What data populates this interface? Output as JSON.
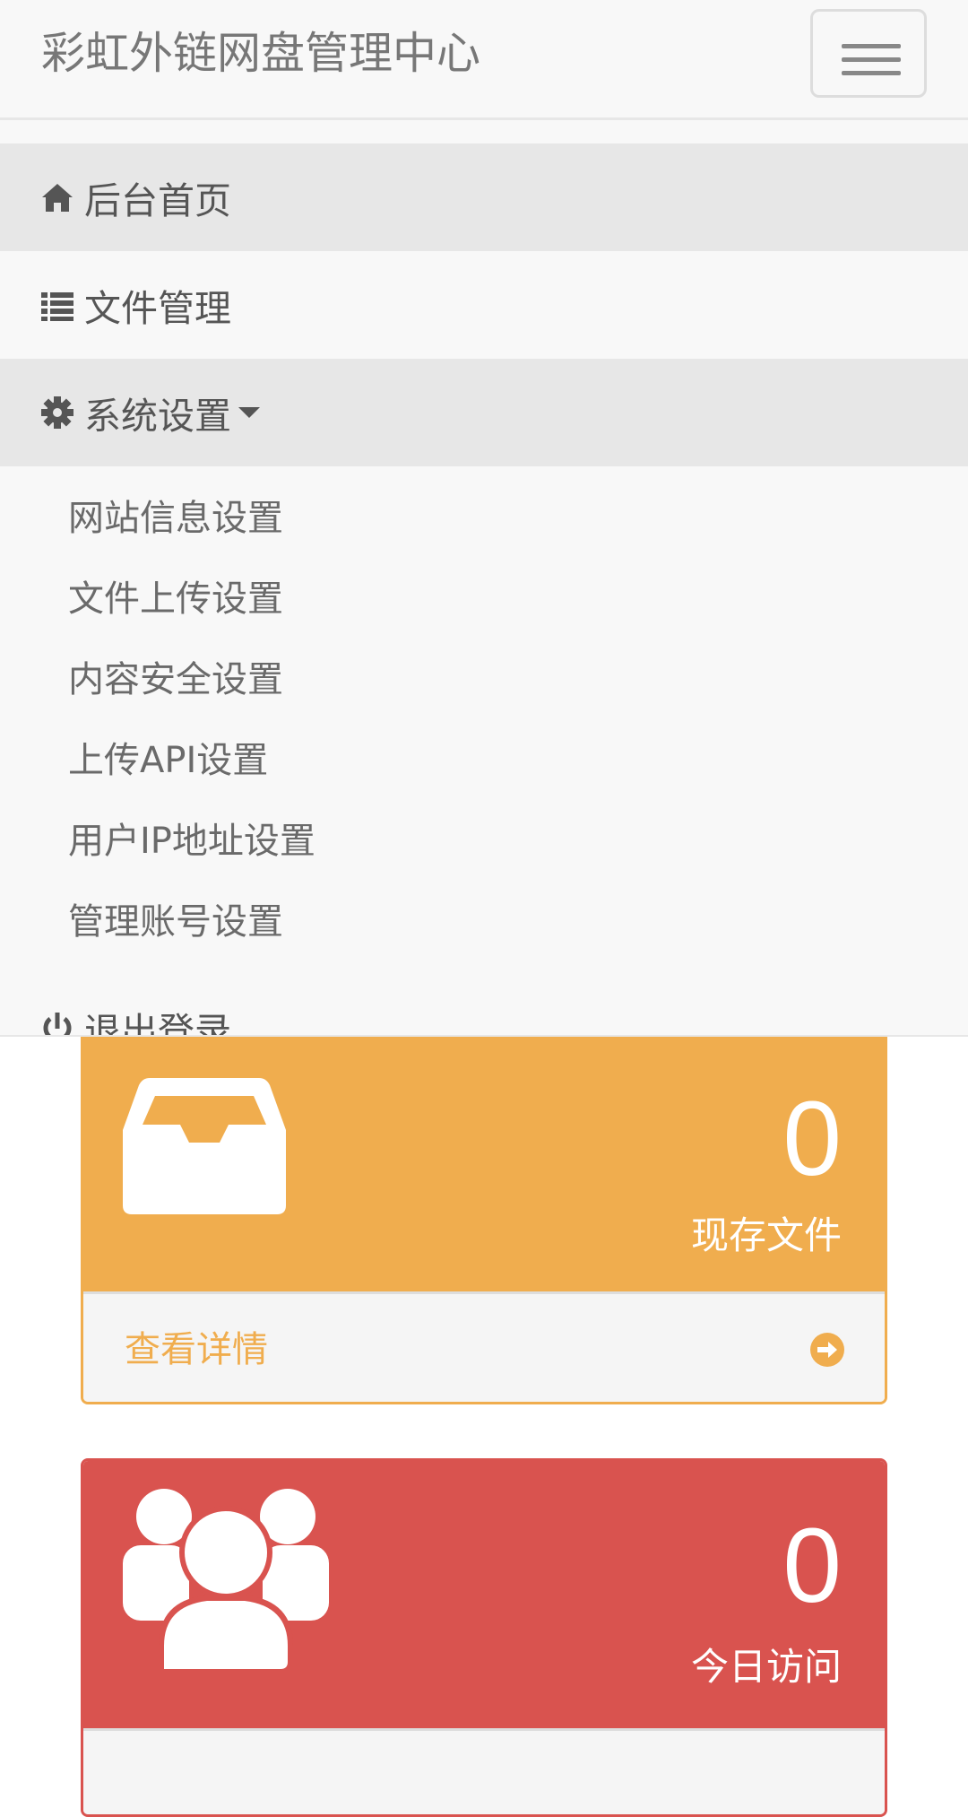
{
  "navbar": {
    "brand": "彩虹外链网盘管理中心",
    "toggle_icon": "hamburger-menu-icon"
  },
  "menu": {
    "items": [
      {
        "label": "后台首页",
        "icon": "home-icon",
        "active": true
      },
      {
        "label": "文件管理",
        "icon": "list-icon",
        "active": false
      },
      {
        "label": "系统设置",
        "icon": "gear-icon",
        "active": true,
        "expanded": true
      },
      {
        "label": "退出登录",
        "icon": "power-icon",
        "active": false
      }
    ],
    "settings_submenu": [
      "网站信息设置",
      "文件上传设置",
      "内容安全设置",
      "上传API设置",
      "用户IP地址设置",
      "管理账号设置"
    ]
  },
  "stats": {
    "files": {
      "value": "0",
      "label": "现存文件",
      "link": "查看详情",
      "icon": "inbox-icon",
      "color": "#f0ad4e"
    },
    "visits": {
      "value": "0",
      "label": "今日访问",
      "icon": "users-icon",
      "color": "#d9534f"
    }
  }
}
